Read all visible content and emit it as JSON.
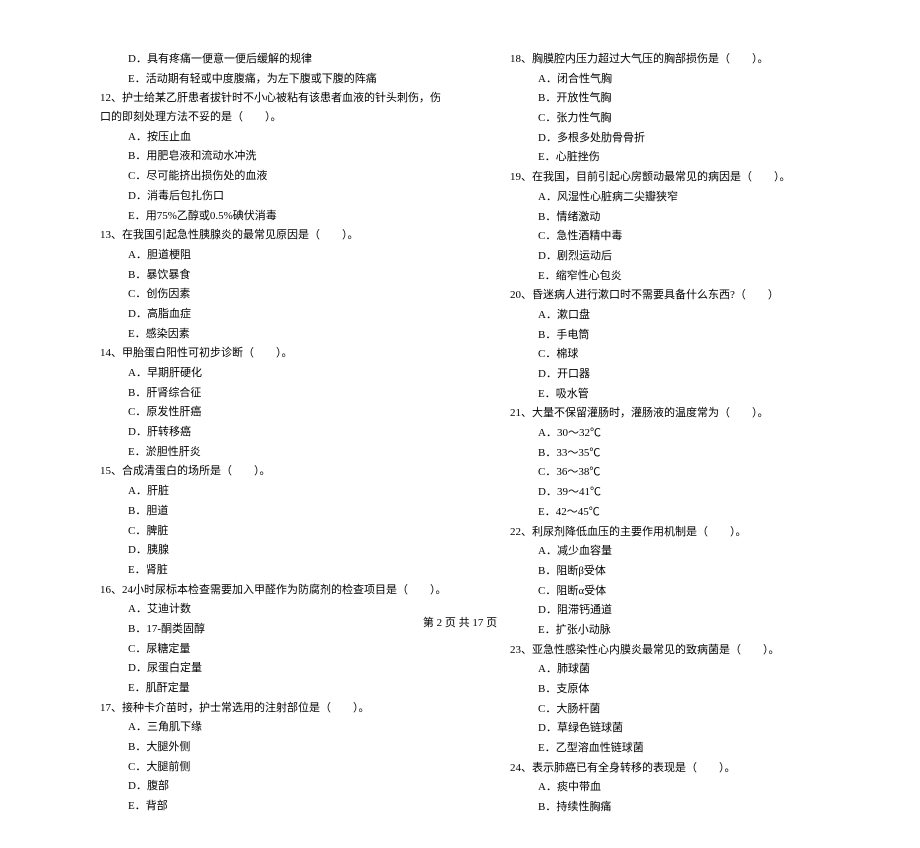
{
  "left_column": {
    "pre_options": [
      "D．具有疼痛一便意一便后缓解的规律",
      "E．活动期有轻或中度腹痛，为左下腹或下腹的阵痛"
    ],
    "q12": {
      "text": "12、护士给某乙肝患者拔针时不小心被粘有该患者血液的针头刺伤，伤口的即刻处理方法不妥的是（　　）。",
      "options": [
        "A．按压止血",
        "B．用肥皂液和流动水冲洗",
        "C．尽可能挤出损伤处的血液",
        "D．消毒后包扎伤口",
        "E．用75%乙醇或0.5%碘伏消毒"
      ]
    },
    "q13": {
      "text": "13、在我国引起急性胰腺炎的最常见原因是（　　）。",
      "options": [
        "A．胆道梗阻",
        "B．暴饮暴食",
        "C．创伤因素",
        "D．高脂血症",
        "E．感染因素"
      ]
    },
    "q14": {
      "text": "14、甲胎蛋白阳性可初步诊断（　　）。",
      "options": [
        "A．早期肝硬化",
        "B．肝肾综合征",
        "C．原发性肝癌",
        "D．肝转移癌",
        "E．淤胆性肝炎"
      ]
    },
    "q15": {
      "text": "15、合成清蛋白的场所是（　　）。",
      "options": [
        "A．肝脏",
        "B．胆道",
        "C．脾脏",
        "D．胰腺",
        "E．肾脏"
      ]
    },
    "q16": {
      "text": "16、24小时尿标本检查需要加入甲醛作为防腐剂的检查项目是（　　）。",
      "options": [
        "A．艾迪计数",
        "B．17-酮类固醇",
        "C．尿糖定量",
        "D．尿蛋白定量",
        "E．肌酐定量"
      ]
    },
    "q17": {
      "text": "17、接种卡介苗时，护士常选用的注射部位是（　　）。",
      "options": [
        "A．三角肌下缘",
        "B．大腿外侧",
        "C．大腿前侧",
        "D．腹部",
        "E．背部"
      ]
    }
  },
  "right_column": {
    "q18": {
      "text": "18、胸膜腔内压力超过大气压的胸部损伤是（　　）。",
      "options": [
        "A．闭合性气胸",
        "B．开放性气胸",
        "C．张力性气胸",
        "D．多根多处肋骨骨折",
        "E．心脏挫伤"
      ]
    },
    "q19": {
      "text": "19、在我国，目前引起心房颤动最常见的病因是（　　）。",
      "options": [
        "A．风湿性心脏病二尖瓣狭窄",
        "B．情绪激动",
        "C．急性酒精中毒",
        "D．剧烈运动后",
        "E．缩窄性心包炎"
      ]
    },
    "q20": {
      "text": "20、昏迷病人进行漱口时不需要具备什么东西?（　　）",
      "options": [
        "A．漱口盘",
        "B．手电筒",
        "C．棉球",
        "D．开口器",
        "E．吸水管"
      ]
    },
    "q21": {
      "text": "21、大量不保留灌肠时，灌肠液的温度常为（　　）。",
      "options": [
        "A．30～32℃",
        "B．33～35℃",
        "C．36～38℃",
        "D．39～41℃",
        "E．42～45℃"
      ]
    },
    "q22": {
      "text": "22、利尿剂降低血压的主要作用机制是（　　）。",
      "options": [
        "A．减少血容量",
        "B．阻断β受体",
        "C．阻断α受体",
        "D．阻滞钙通道",
        "E．扩张小动脉"
      ]
    },
    "q23": {
      "text": "23、亚急性感染性心内膜炎最常见的致病菌是（　　）。",
      "options": [
        "A．肺球菌",
        "B．支原体",
        "C．大肠杆菌",
        "D．草绿色链球菌",
        "E．乙型溶血性链球菌"
      ]
    },
    "q24": {
      "text": "24、表示肺癌已有全身转移的表现是（　　）。",
      "options": [
        "A．痰中带血",
        "B．持续性胸痛"
      ]
    }
  },
  "footer": "第 2 页 共 17 页"
}
